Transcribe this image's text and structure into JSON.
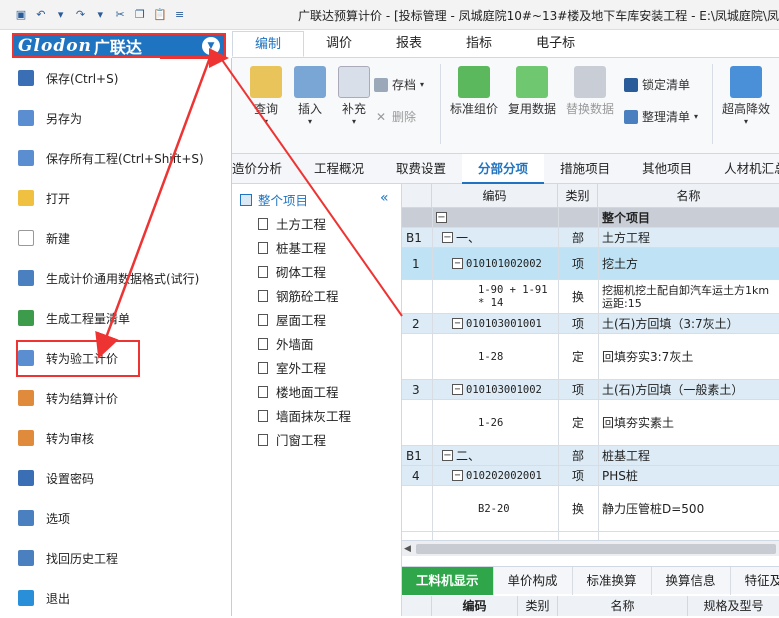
{
  "window": {
    "title": "广联达预算计价 - [投标管理 - 凤城庭院10#~13#楼及地下车库安装工程 - E:\\凤城庭院\\凤城"
  },
  "logo": {
    "text": "Glodon",
    "cn": "广联达"
  },
  "ribbon": {
    "tabs": [
      "编制",
      "调价",
      "报表",
      "指标",
      "电子标"
    ],
    "buttons": {
      "query": "查询",
      "insert": "插入",
      "supplement": "补充",
      "save_archive": "存档",
      "delete": "删除",
      "standard_group": "标准组价",
      "reuse_data": "复用数据",
      "replace_data": "替换数据",
      "lock_list": "锁定清单",
      "organize_list": "整理清单",
      "super_downgrade": "超高降效"
    }
  },
  "menu": {
    "items": [
      "保存(Ctrl+S)",
      "另存为",
      "保存所有工程(Ctrl+Shift+S)",
      "打开",
      "新建",
      "生成计价通用数据格式(试行)",
      "生成工程量清单",
      "转为验工计价",
      "转为结算计价",
      "转为审核",
      "设置密码",
      "选项",
      "找回历史工程",
      "退出"
    ]
  },
  "doc_tabs": [
    "造价分析",
    "工程概况",
    "取费设置",
    "分部分项",
    "措施项目",
    "其他项目",
    "人材机汇总"
  ],
  "tree": {
    "root": "整个项目",
    "items": [
      "土方工程",
      "桩基工程",
      "砌体工程",
      "钢筋砼工程",
      "屋面工程",
      "外墙面",
      "室外工程",
      "楼地面工程",
      "墙面抹灰工程",
      "门窗工程"
    ]
  },
  "grid": {
    "columns": [
      "编码",
      "类别",
      "名称"
    ],
    "rows": [
      {
        "no": "",
        "code": "",
        "type": "",
        "name": "整个项目"
      },
      {
        "no": "B1",
        "code": "一、",
        "type": "部",
        "name": "土方工程"
      },
      {
        "no": "1",
        "code": "010101002002",
        "type": "项",
        "name": "挖土方"
      },
      {
        "no": "",
        "code": "1-90 + 1-91 * 14",
        "type": "换",
        "name": "挖掘机挖土配自卸汽车运土方1km 运距:15"
      },
      {
        "no": "2",
        "code": "010103001001",
        "type": "项",
        "name": "土(石)方回填（3:7灰土）"
      },
      {
        "no": "",
        "code": "1-28",
        "type": "定",
        "name": "回填夯实3:7灰土"
      },
      {
        "no": "3",
        "code": "010103001002",
        "type": "项",
        "name": "土(石)方回填（一般素土）"
      },
      {
        "no": "",
        "code": "1-26",
        "type": "定",
        "name": "回填夯实素土"
      },
      {
        "no": "B1",
        "code": "二、",
        "type": "部",
        "name": "桩基工程"
      },
      {
        "no": "4",
        "code": "010202002001",
        "type": "项",
        "name": "PHS桩"
      },
      {
        "no": "",
        "code": "B2-20",
        "type": "换",
        "name": "静力压管桩D=500"
      }
    ]
  },
  "bottom_tabs": [
    "工料机显示",
    "单价构成",
    "标准换算",
    "换算信息",
    "特征及"
  ],
  "bottom_columns": [
    "编码",
    "类别",
    "名称",
    "规格及型号"
  ],
  "colors": {
    "accent": "#1f74c2",
    "annotation": "#e33333",
    "selected_row": "#bfe3f5",
    "green_tab": "#2fa64a"
  }
}
